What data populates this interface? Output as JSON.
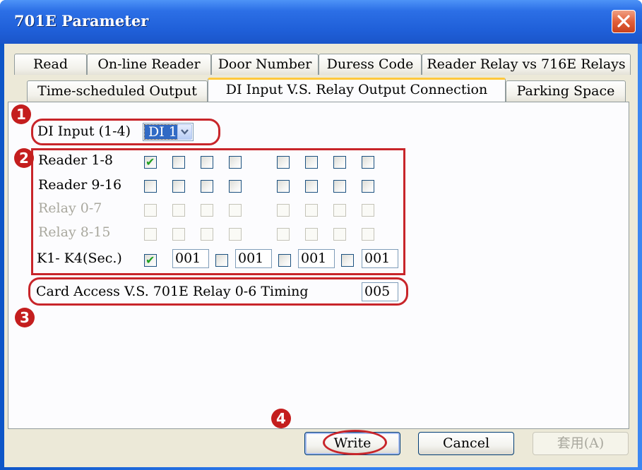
{
  "window": {
    "title": "701E Parameter"
  },
  "tabs_row1": [
    "Read",
    "On-line Reader",
    "Door Number",
    "Duress Code",
    "Reader Relay vs 716E Relays"
  ],
  "tabs_row2": [
    "Time-scheduled Output",
    "DI Input  V.S. Relay Output Connection",
    "Parking Space"
  ],
  "active_tab": "DI Input  V.S. Relay Output Connection",
  "di_input": {
    "label": "DI Input (1-4)",
    "selected": "DI 1"
  },
  "rows": {
    "reader_1_8": {
      "label": "Reader 1-8",
      "checked": [
        true,
        false,
        false,
        false,
        false,
        false,
        false,
        false
      ]
    },
    "reader_9_16": {
      "label": "Reader 9-16",
      "checked": [
        false,
        false,
        false,
        false,
        false,
        false,
        false,
        false
      ]
    },
    "relay_0_7": {
      "label": "Relay  0-7",
      "disabled": true
    },
    "relay_8_15": {
      "label": "Relay  8-15",
      "disabled": true
    },
    "k1_k4": {
      "label": "K1- K4(Sec.)",
      "checked": [
        true,
        false,
        false,
        false
      ],
      "values": [
        "001",
        "001",
        "001",
        "001"
      ]
    }
  },
  "card_access": {
    "label": "Card Access V.S. 701E Relay 0-6 Timing",
    "value": "005"
  },
  "buttons": {
    "write": "Write",
    "cancel": "Cancel",
    "apply": "套用(A)"
  },
  "annotations": [
    "1",
    "2",
    "3",
    "4"
  ],
  "colors": {
    "annotation_red": "#c8252a",
    "titlebar_blue": "#1f5fd8",
    "check_green": "#21a121",
    "active_tab_accent": "#ffc83c"
  }
}
